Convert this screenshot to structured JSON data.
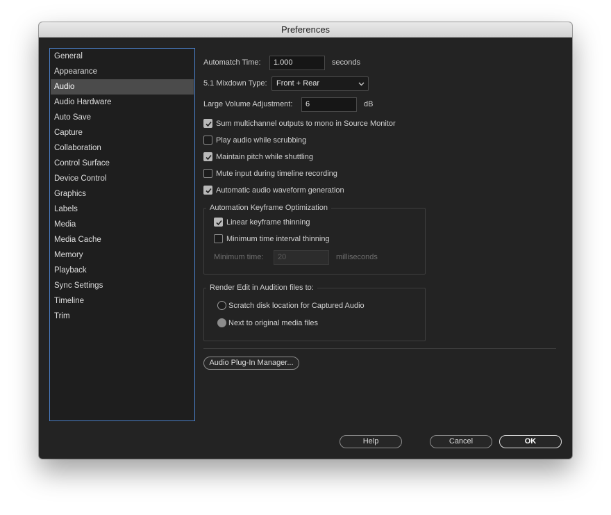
{
  "window": {
    "title": "Preferences"
  },
  "sidebar": {
    "items": [
      {
        "label": "General"
      },
      {
        "label": "Appearance"
      },
      {
        "label": "Audio",
        "selected": true
      },
      {
        "label": "Audio Hardware"
      },
      {
        "label": "Auto Save"
      },
      {
        "label": "Capture"
      },
      {
        "label": "Collaboration"
      },
      {
        "label": "Control Surface"
      },
      {
        "label": "Device Control"
      },
      {
        "label": "Graphics"
      },
      {
        "label": "Labels"
      },
      {
        "label": "Media"
      },
      {
        "label": "Media Cache"
      },
      {
        "label": "Memory"
      },
      {
        "label": "Playback"
      },
      {
        "label": "Sync Settings"
      },
      {
        "label": "Timeline"
      },
      {
        "label": "Trim"
      }
    ]
  },
  "audio": {
    "automatch_label": "Automatch Time:",
    "automatch_value": "1.000",
    "automatch_unit": "seconds",
    "mixdown_label": "5.1 Mixdown Type:",
    "mixdown_value": "Front + Rear",
    "volume_label": "Large Volume Adjustment:",
    "volume_value": "6",
    "volume_unit": "dB",
    "checkboxes": [
      {
        "label": "Sum multichannel outputs to mono in Source Monitor",
        "checked": true
      },
      {
        "label": "Play audio while scrubbing",
        "checked": false
      },
      {
        "label": "Maintain pitch while shuttling",
        "checked": true
      },
      {
        "label": "Mute input during timeline recording",
        "checked": false
      },
      {
        "label": "Automatic audio waveform generation",
        "checked": true
      }
    ],
    "keyframe_group": {
      "title": "Automation Keyframe Optimization",
      "linear_label": "Linear keyframe thinning",
      "linear_checked": true,
      "min_interval_label": "Minimum time interval thinning",
      "min_interval_checked": false,
      "min_time_label": "Minimum time:",
      "min_time_value": "20",
      "min_time_unit": "milliseconds"
    },
    "render_group": {
      "title": "Render Edit in Audition files to:",
      "options": [
        {
          "label": "Scratch disk location for Captured Audio",
          "selected": false
        },
        {
          "label": "Next to original media files",
          "selected": true
        }
      ]
    },
    "plugin_manager_label": "Audio Plug-In Manager..."
  },
  "footer": {
    "help_label": "Help",
    "cancel_label": "Cancel",
    "ok_label": "OK"
  }
}
